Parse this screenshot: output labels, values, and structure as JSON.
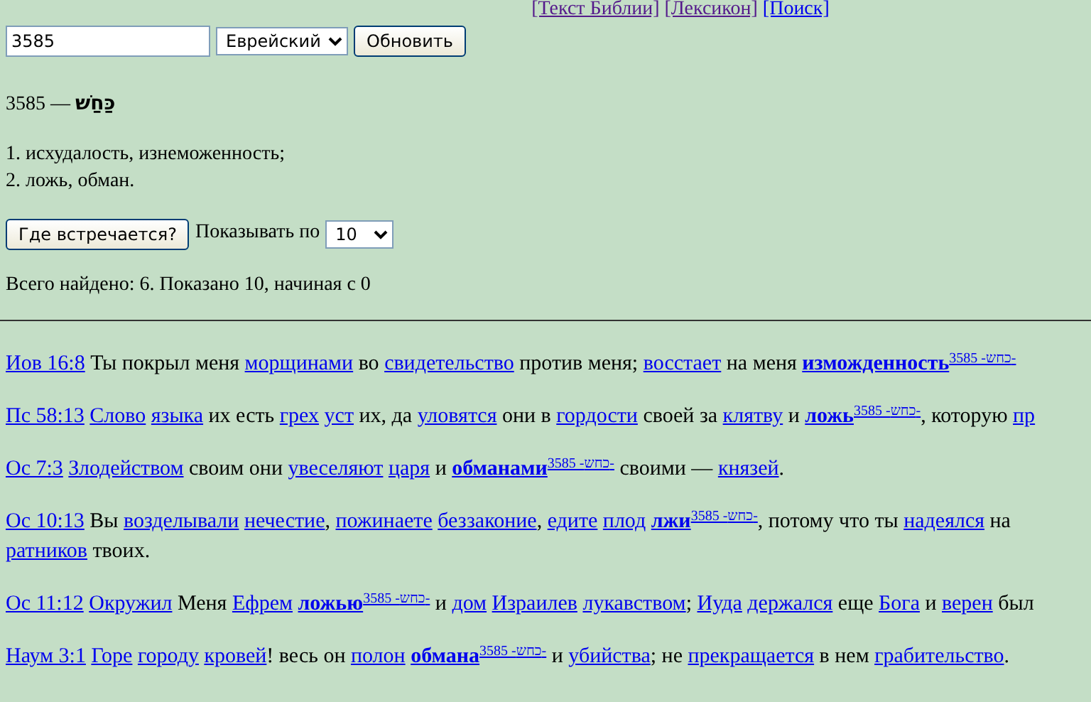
{
  "top_links": [
    {
      "text": "[Текст Библии]",
      "visited": true
    },
    {
      "text": "[Лексикон]",
      "visited": true
    },
    {
      "text": "[Поиск]",
      "visited": false
    }
  ],
  "search": {
    "value": "3585",
    "language": "Еврейский",
    "button": "Обновить"
  },
  "entry": {
    "number": "3585 —",
    "hebrew": "כַּחַשׁ"
  },
  "definitions": [
    "1. исхудалость, изнеможенность;",
    "2. ложь, обман."
  ],
  "occurrences": {
    "button": "Где встречается?",
    "per_page_label": "Показывать по",
    "per_page": "10"
  },
  "summary": "Всего найдено: 6. Показано 10, начиная с 0",
  "verses": [
    {
      "ref": "Иов 16:8",
      "segments": [
        {
          "kind": "text",
          "text": "Ты покрыл меня"
        },
        {
          "kind": "link",
          "text": "морщинами"
        },
        {
          "kind": "text",
          "text": "во"
        },
        {
          "kind": "link",
          "text": "свидетельство"
        },
        {
          "kind": "text",
          "text": "против меня;"
        },
        {
          "kind": "link",
          "text": "восстает"
        },
        {
          "kind": "text",
          "text": "на меня"
        },
        {
          "kind": "match",
          "text": "изможденность"
        },
        {
          "kind": "strong",
          "text": "3585 -כחש-"
        }
      ]
    },
    {
      "ref": "Пс 58:13",
      "segments": [
        {
          "kind": "link",
          "text": "Слово"
        },
        {
          "kind": "link",
          "text": "языка"
        },
        {
          "kind": "text",
          "text": "их есть"
        },
        {
          "kind": "link",
          "text": "грех"
        },
        {
          "kind": "link",
          "text": "уст"
        },
        {
          "kind": "text",
          "text": "их, да"
        },
        {
          "kind": "link",
          "text": "уловятся"
        },
        {
          "kind": "text",
          "text": "они в"
        },
        {
          "kind": "link",
          "text": "гордости"
        },
        {
          "kind": "text",
          "text": "своей за"
        },
        {
          "kind": "link",
          "text": "клятву"
        },
        {
          "kind": "text",
          "text": "и"
        },
        {
          "kind": "match",
          "text": "ложь"
        },
        {
          "kind": "strong",
          "text": "3585 -כחש-"
        },
        {
          "kind": "text",
          "text": ", которую",
          "tight": true
        },
        {
          "kind": "link",
          "text": "пр"
        }
      ]
    },
    {
      "ref": "Ос 7:3",
      "segments": [
        {
          "kind": "link",
          "text": "Злодейством"
        },
        {
          "kind": "text",
          "text": "своим они"
        },
        {
          "kind": "link",
          "text": "увеселяют"
        },
        {
          "kind": "link",
          "text": "царя"
        },
        {
          "kind": "text",
          "text": "и"
        },
        {
          "kind": "match",
          "text": "обманами"
        },
        {
          "kind": "strong",
          "text": "3585 -כחש-"
        },
        {
          "kind": "text",
          "text": "своими —"
        },
        {
          "kind": "link",
          "text": "князей"
        },
        {
          "kind": "text",
          "text": ".",
          "tight": true
        }
      ]
    },
    {
      "ref": "Ос 10:13",
      "segments": [
        {
          "kind": "text",
          "text": "Вы"
        },
        {
          "kind": "link",
          "text": "возделывали"
        },
        {
          "kind": "link",
          "text": "нечестие"
        },
        {
          "kind": "text",
          "text": ",",
          "tight": true
        },
        {
          "kind": "link",
          "text": "пожинаете"
        },
        {
          "kind": "link",
          "text": "беззаконие"
        },
        {
          "kind": "text",
          "text": ",",
          "tight": true
        },
        {
          "kind": "link",
          "text": "едите"
        },
        {
          "kind": "link",
          "text": "плод"
        },
        {
          "kind": "match",
          "text": "лжи"
        },
        {
          "kind": "strong",
          "text": "3585 -כחש-"
        },
        {
          "kind": "text",
          "text": ", потому что ты",
          "tight": true
        },
        {
          "kind": "link",
          "text": "надеялся"
        },
        {
          "kind": "text",
          "text": "на"
        },
        {
          "kind": "link",
          "text": "ратников"
        },
        {
          "kind": "text",
          "text": "твоих."
        }
      ]
    },
    {
      "ref": "Ос 11:12",
      "segments": [
        {
          "kind": "link",
          "text": "Окружил"
        },
        {
          "kind": "text",
          "text": "Меня"
        },
        {
          "kind": "link",
          "text": "Ефрем"
        },
        {
          "kind": "match",
          "text": "ложью"
        },
        {
          "kind": "strong",
          "text": "3585 -כחש-"
        },
        {
          "kind": "text",
          "text": "и"
        },
        {
          "kind": "link",
          "text": "дом"
        },
        {
          "kind": "link",
          "text": "Израилев"
        },
        {
          "kind": "link",
          "text": "лукавством"
        },
        {
          "kind": "text",
          "text": ";",
          "tight": true
        },
        {
          "kind": "link",
          "text": "Иуда"
        },
        {
          "kind": "link",
          "text": "держался"
        },
        {
          "kind": "text",
          "text": "еще"
        },
        {
          "kind": "link",
          "text": "Бога"
        },
        {
          "kind": "text",
          "text": "и"
        },
        {
          "kind": "link",
          "text": "верен"
        },
        {
          "kind": "text",
          "text": "был"
        }
      ]
    },
    {
      "ref": "Наум 3:1",
      "segments": [
        {
          "kind": "link",
          "text": "Горе"
        },
        {
          "kind": "link",
          "text": "городу"
        },
        {
          "kind": "link",
          "text": "кровей"
        },
        {
          "kind": "text",
          "text": "! весь он",
          "tight": true
        },
        {
          "kind": "link",
          "text": "полон"
        },
        {
          "kind": "match",
          "text": "обмана"
        },
        {
          "kind": "strong",
          "text": "3585 -כחש-"
        },
        {
          "kind": "text",
          "text": "и"
        },
        {
          "kind": "link",
          "text": "убийства"
        },
        {
          "kind": "text",
          "text": "; не",
          "tight": true
        },
        {
          "kind": "link",
          "text": "прекращается"
        },
        {
          "kind": "text",
          "text": "в нем"
        },
        {
          "kind": "link",
          "text": "грабительство"
        },
        {
          "kind": "text",
          "text": ".",
          "tight": true
        }
      ]
    }
  ]
}
